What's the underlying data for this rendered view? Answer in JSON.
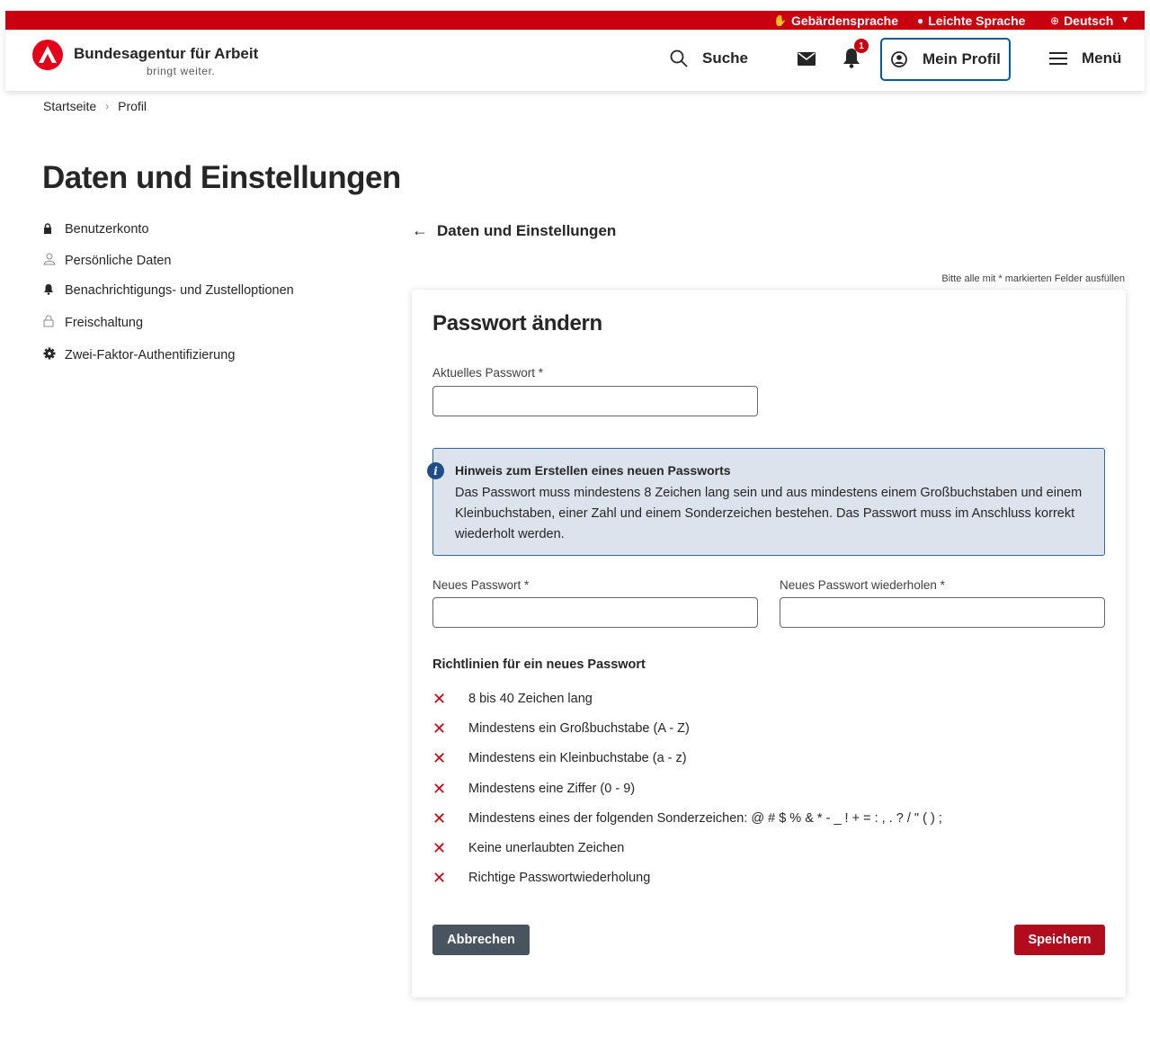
{
  "utility_bar": {
    "sign_language": "Gebärdensprache",
    "easy_language": "Leichte Sprache",
    "language": "Deutsch"
  },
  "header": {
    "brand_name": "Bundesagentur für Arbeit",
    "brand_tagline": "bringt weiter.",
    "search_label": "Suche",
    "notification_count": "1",
    "profile_label": "Mein Profil",
    "menu_label": "Menü"
  },
  "breadcrumb": {
    "home": "Startseite",
    "current": "Profil"
  },
  "page_title": "Daten und Einstellungen",
  "sidebar": {
    "items": [
      {
        "label": "Benutzerkonto",
        "icon": "lock-icon"
      },
      {
        "label": "Persönliche Daten",
        "icon": "person-icon"
      },
      {
        "label": "Benachrichtigungs- und Zustelloptionen",
        "icon": "bell-icon"
      },
      {
        "label": "Freischaltung",
        "icon": "unlock-icon"
      },
      {
        "label": "Zwei-Faktor-Authentifizierung",
        "icon": "gear-icon"
      }
    ]
  },
  "content": {
    "back_label": "Daten und Einstellungen",
    "required_note": "Bitte alle mit * markierten Felder ausfüllen",
    "form": {
      "title": "Passwort ändern",
      "current_password_label": "Aktuelles Passwort *",
      "current_password_value": "",
      "new_password_label": "Neues Passwort *",
      "new_password_value": "",
      "repeat_password_label": "Neues Passwort wiederholen *",
      "repeat_password_value": ""
    },
    "hint": {
      "title": "Hinweis zum Erstellen eines neuen Passworts",
      "text": "Das Passwort muss mindestens 8 Zeichen lang sein und aus mindestens einem Großbuchstaben und einem Kleinbuchstaben, einer Zahl und einem Sonderzeichen bestehen. Das Passwort muss im Anschluss korrekt wiederholt werden."
    },
    "rules": {
      "title": "Richtlinien für ein neues Passwort",
      "items": [
        "8 bis 40 Zeichen lang",
        "Mindestens ein Großbuchstabe (A - Z)",
        "Mindestens ein Kleinbuchstabe (a - z)",
        "Mindestens eine Ziffer (0 - 9)",
        "Mindestens eines der folgenden Sonderzeichen: @ # $ % & * - _ ! + = : , . ? / \" ( ) ;",
        "Keine unerlaubten Zeichen",
        "Richtige Passwortwiederholung"
      ],
      "status_icon": "cross-icon"
    },
    "buttons": {
      "cancel": "Abbrechen",
      "save": "Speichern"
    }
  },
  "colors": {
    "brand_red": "#c8000f",
    "profile_border": "#005c9c",
    "hint_bg": "#dde3ec",
    "hint_border": "#2b66a3",
    "cancel_bg": "#4a5360",
    "save_bg": "#b00c1e"
  }
}
